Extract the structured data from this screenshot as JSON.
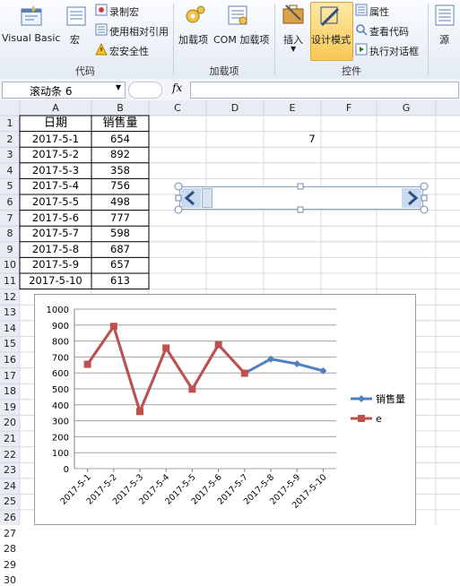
{
  "ribbon": {
    "visual_basic": "Visual Basic",
    "macro": "宏",
    "record_macro": "录制宏",
    "relative_ref": "使用相对引用",
    "macro_security": "宏安全性",
    "group_code": "代码",
    "addins": "加载项",
    "com_addins": "COM 加载项",
    "group_addins": "加载项",
    "insert": "插入",
    "design_mode": "设计模式",
    "properties": "属性",
    "view_code": "查看代码",
    "run_dialog": "执行对话框",
    "group_controls": "控件",
    "source": "源"
  },
  "formula_bar": {
    "name_box": "滚动条 6",
    "fx": "fx",
    "formula": ""
  },
  "columns": [
    "A",
    "B",
    "C",
    "D",
    "E",
    "F",
    "G"
  ],
  "rows": [
    "1",
    "2",
    "3",
    "4",
    "5",
    "6",
    "7",
    "8",
    "9",
    "10",
    "11",
    "12",
    "13",
    "14",
    "15",
    "16",
    "17",
    "18",
    "19",
    "20",
    "21",
    "22",
    "23",
    "24",
    "25",
    "26",
    "27",
    "28",
    "29",
    "30"
  ],
  "table": {
    "headers": [
      "日期",
      "销售量"
    ],
    "rows": [
      [
        "2017-5-1",
        "654"
      ],
      [
        "2017-5-2",
        "892"
      ],
      [
        "2017-5-3",
        "358"
      ],
      [
        "2017-5-4",
        "756"
      ],
      [
        "2017-5-5",
        "498"
      ],
      [
        "2017-5-6",
        "777"
      ],
      [
        "2017-5-7",
        "598"
      ],
      [
        "2017-5-8",
        "687"
      ],
      [
        "2017-5-9",
        "657"
      ],
      [
        "2017-5-10",
        "613"
      ]
    ]
  },
  "e2_value": "7",
  "chart_data": {
    "type": "line",
    "categories": [
      "2017-5-1",
      "2017-5-2",
      "2017-5-3",
      "2017-5-4",
      "2017-5-5",
      "2017-5-6",
      "2017-5-7",
      "2017-5-8",
      "2017-5-9",
      "2017-5-10"
    ],
    "series": [
      {
        "name": "销售量",
        "values": [
          654,
          892,
          358,
          756,
          498,
          777,
          598,
          687,
          657,
          613
        ],
        "color": "#4f81bd"
      },
      {
        "name": "e",
        "values": [
          654,
          892,
          358,
          756,
          498,
          777,
          598
        ],
        "color": "#c0504d"
      }
    ],
    "yticks": [
      "0",
      "100",
      "200",
      "300",
      "400",
      "500",
      "600",
      "700",
      "800",
      "900",
      "1000"
    ],
    "ylim": [
      0,
      1000
    ],
    "legend": "right"
  }
}
